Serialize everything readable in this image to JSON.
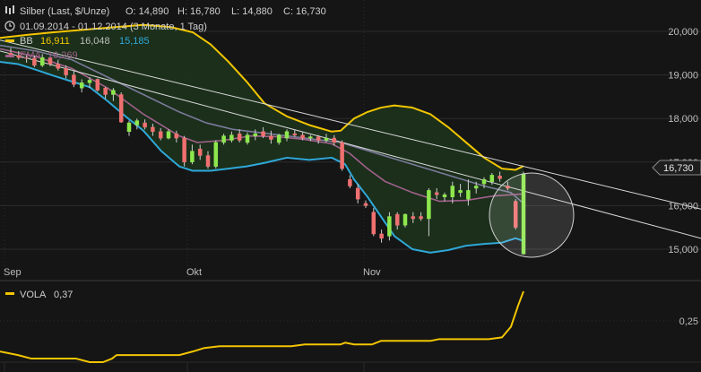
{
  "header": {
    "instrument_line": "Silber (Last, $/Unze)",
    "open": "O: 14,890",
    "high": "H: 16,780",
    "low": "L: 14,880",
    "close": "C: 16,730",
    "period_line": "01.09.2014 - 01.12.2014 (3 Monate, 1 Tag)",
    "bb_label": "BB",
    "bb_values": [
      "16,911",
      "16,048",
      "15,185"
    ],
    "ema_label": "EMA",
    "ema_value": "16,269"
  },
  "price_tag": "16,730",
  "vola": {
    "label": "VOLA",
    "value": "0,37"
  },
  "colors": {
    "background": "#151515",
    "grid": "#2c2c2c",
    "bb_upper": "#f2c500",
    "bb_lower": "#2fa8d8",
    "bb_mid": "#c8c8c8",
    "bb_fill": "#1b301b",
    "ema": "#a0608a",
    "sma": "#7a7a9a",
    "up": "#8ee84d",
    "down": "#f07070",
    "vola": "#f2c500"
  },
  "chart_data": {
    "type": "candlestick",
    "instrument": "Silber",
    "y_ticks": [
      "20,000",
      "19,000",
      "18,000",
      "17,000",
      "16,000",
      "15,000"
    ],
    "ylim": [
      14.6,
      20.4
    ],
    "x_labels": [
      "Sep",
      "Okt",
      "Nov"
    ],
    "candles": [
      [
        19.5,
        19.62,
        19.4,
        19.45
      ],
      [
        19.45,
        19.55,
        19.35,
        19.4
      ],
      [
        19.4,
        19.45,
        19.28,
        19.38
      ],
      [
        19.38,
        19.45,
        19.18,
        19.22
      ],
      [
        19.22,
        19.48,
        19.18,
        19.4
      ],
      [
        19.4,
        19.42,
        19.2,
        19.25
      ],
      [
        19.25,
        19.35,
        19.1,
        19.15
      ],
      [
        19.15,
        19.22,
        18.92,
        19.0
      ],
      [
        19.0,
        19.1,
        18.72,
        18.78
      ],
      [
        18.7,
        18.9,
        18.6,
        18.82
      ],
      [
        18.82,
        18.95,
        18.7,
        18.88
      ],
      [
        18.9,
        18.92,
        18.62,
        18.65
      ],
      [
        18.7,
        18.72,
        18.45,
        18.55
      ],
      [
        18.55,
        18.7,
        18.4,
        18.65
      ],
      [
        18.55,
        18.6,
        17.9,
        17.92
      ],
      [
        17.7,
        17.95,
        17.6,
        17.9
      ],
      [
        17.85,
        18.0,
        17.75,
        17.95
      ],
      [
        17.9,
        17.98,
        17.75,
        17.8
      ],
      [
        17.8,
        17.88,
        17.6,
        17.7
      ],
      [
        17.7,
        17.78,
        17.5,
        17.55
      ],
      [
        17.55,
        17.75,
        17.52,
        17.7
      ],
      [
        17.65,
        17.72,
        17.45,
        17.55
      ],
      [
        17.55,
        17.6,
        16.9,
        17.0
      ],
      [
        17.0,
        17.4,
        16.95,
        17.25
      ],
      [
        17.3,
        17.4,
        17.05,
        17.15
      ],
      [
        17.15,
        17.25,
        16.85,
        16.9
      ],
      [
        16.9,
        17.5,
        16.85,
        17.45
      ],
      [
        17.45,
        17.65,
        17.4,
        17.6
      ],
      [
        17.5,
        17.7,
        17.45,
        17.62
      ],
      [
        17.65,
        17.75,
        17.45,
        17.5
      ],
      [
        17.45,
        17.68,
        17.4,
        17.62
      ],
      [
        17.6,
        17.75,
        17.5,
        17.65
      ],
      [
        17.7,
        17.8,
        17.55,
        17.6
      ],
      [
        17.6,
        17.72,
        17.42,
        17.52
      ],
      [
        17.45,
        17.65,
        17.4,
        17.62
      ],
      [
        17.55,
        17.75,
        17.48,
        17.7
      ],
      [
        17.65,
        17.75,
        17.58,
        17.62
      ],
      [
        17.62,
        17.68,
        17.5,
        17.55
      ],
      [
        17.55,
        17.62,
        17.48,
        17.58
      ],
      [
        17.58,
        17.62,
        17.42,
        17.5
      ],
      [
        17.5,
        17.65,
        17.45,
        17.55
      ],
      [
        17.55,
        17.62,
        17.38,
        17.45
      ],
      [
        17.45,
        17.5,
        16.8,
        16.85
      ],
      [
        16.6,
        16.7,
        16.4,
        16.45
      ],
      [
        16.4,
        16.5,
        16.05,
        16.15
      ],
      [
        16.05,
        16.12,
        15.95,
        16.0
      ],
      [
        15.85,
        15.95,
        15.3,
        15.35
      ],
      [
        15.35,
        15.45,
        15.15,
        15.25
      ],
      [
        15.3,
        15.85,
        15.2,
        15.75
      ],
      [
        15.8,
        15.85,
        15.45,
        15.55
      ],
      [
        15.55,
        15.82,
        15.5,
        15.8
      ],
      [
        15.75,
        15.85,
        15.6,
        15.7
      ],
      [
        15.75,
        15.85,
        15.65,
        15.7
      ],
      [
        15.7,
        16.4,
        15.3,
        16.35
      ],
      [
        16.3,
        16.4,
        16.15,
        16.25
      ],
      [
        16.2,
        16.3,
        16.1,
        16.25
      ],
      [
        16.2,
        16.55,
        16.05,
        16.45
      ],
      [
        16.3,
        16.5,
        16.2,
        16.35
      ],
      [
        16.15,
        16.6,
        16.0,
        16.35
      ],
      [
        16.4,
        16.55,
        16.28,
        16.45
      ],
      [
        16.5,
        16.65,
        16.4,
        16.6
      ],
      [
        16.55,
        16.75,
        16.48,
        16.7
      ],
      [
        16.68,
        16.78,
        16.55,
        16.62
      ],
      [
        16.45,
        16.55,
        16.35,
        16.4
      ],
      [
        16.1,
        16.15,
        15.45,
        15.5
      ],
      [
        14.89,
        16.78,
        14.88,
        16.73
      ]
    ],
    "bb_upper": [
      [
        0,
        19.85
      ],
      [
        30,
        19.92
      ],
      [
        60,
        19.98
      ],
      [
        100,
        20.05
      ],
      [
        130,
        20.1
      ],
      [
        160,
        20.15
      ],
      [
        190,
        20.1
      ],
      [
        215,
        19.98
      ],
      [
        235,
        19.7
      ],
      [
        255,
        19.3
      ],
      [
        275,
        18.85
      ],
      [
        295,
        18.35
      ],
      [
        320,
        18.05
      ],
      [
        345,
        17.85
      ],
      [
        370,
        17.7
      ],
      [
        380,
        17.72
      ],
      [
        395,
        18.0
      ],
      [
        410,
        18.15
      ],
      [
        425,
        18.25
      ],
      [
        440,
        18.3
      ],
      [
        460,
        18.25
      ],
      [
        480,
        18.1
      ],
      [
        500,
        17.8
      ],
      [
        520,
        17.45
      ],
      [
        540,
        17.1
      ],
      [
        560,
        16.85
      ],
      [
        575,
        16.82
      ],
      [
        584,
        16.91
      ]
    ],
    "bb_lower": [
      [
        0,
        19.3
      ],
      [
        20,
        19.25
      ],
      [
        40,
        19.12
      ],
      [
        60,
        18.98
      ],
      [
        80,
        18.85
      ],
      [
        100,
        18.72
      ],
      [
        120,
        18.4
      ],
      [
        140,
        18.05
      ],
      [
        160,
        17.72
      ],
      [
        180,
        17.25
      ],
      [
        200,
        16.9
      ],
      [
        215,
        16.8
      ],
      [
        235,
        16.8
      ],
      [
        255,
        16.85
      ],
      [
        275,
        16.9
      ],
      [
        295,
        16.98
      ],
      [
        320,
        17.1
      ],
      [
        345,
        17.05
      ],
      [
        370,
        17.1
      ],
      [
        385,
        16.95
      ],
      [
        395,
        16.6
      ],
      [
        410,
        16.2
      ],
      [
        425,
        15.75
      ],
      [
        440,
        15.3
      ],
      [
        460,
        15.0
      ],
      [
        480,
        14.92
      ],
      [
        500,
        14.98
      ],
      [
        520,
        15.08
      ],
      [
        540,
        15.12
      ],
      [
        560,
        15.15
      ],
      [
        575,
        15.25
      ],
      [
        584,
        15.19
      ]
    ],
    "ema": [
      [
        0,
        19.6
      ],
      [
        40,
        19.42
      ],
      [
        80,
        19.15
      ],
      [
        120,
        18.7
      ],
      [
        160,
        18.1
      ],
      [
        200,
        17.6
      ],
      [
        220,
        17.45
      ],
      [
        250,
        17.5
      ],
      [
        280,
        17.6
      ],
      [
        310,
        17.58
      ],
      [
        340,
        17.52
      ],
      [
        370,
        17.42
      ],
      [
        390,
        17.2
      ],
      [
        410,
        16.85
      ],
      [
        430,
        16.55
      ],
      [
        460,
        16.3
      ],
      [
        490,
        16.1
      ],
      [
        520,
        16.12
      ],
      [
        550,
        16.22
      ],
      [
        570,
        16.25
      ],
      [
        584,
        16.27
      ]
    ],
    "sma": [
      [
        0,
        19.68
      ],
      [
        40,
        19.55
      ],
      [
        80,
        19.35
      ],
      [
        120,
        18.95
      ],
      [
        160,
        18.55
      ],
      [
        200,
        18.15
      ],
      [
        230,
        17.9
      ],
      [
        260,
        17.75
      ],
      [
        300,
        17.65
      ],
      [
        340,
        17.55
      ],
      [
        380,
        17.45
      ],
      [
        420,
        17.2
      ],
      [
        460,
        16.95
      ],
      [
        500,
        16.7
      ],
      [
        540,
        16.45
      ],
      [
        570,
        16.3
      ],
      [
        584,
        16.05
      ]
    ],
    "trendlines": [
      [
        [
          0,
          19.8
        ],
        [
          782,
          15.92
        ]
      ],
      [
        [
          0,
          19.55
        ],
        [
          782,
          15.25
        ]
      ]
    ],
    "vola": {
      "label": "VOLA",
      "value": "0,37",
      "y_ticks": [
        "0,25"
      ],
      "points": [
        [
          0,
          0.2
        ],
        [
          20,
          0.19
        ],
        [
          35,
          0.18
        ],
        [
          60,
          0.18
        ],
        [
          85,
          0.18
        ],
        [
          100,
          0.17
        ],
        [
          115,
          0.17
        ],
        [
          125,
          0.18
        ],
        [
          130,
          0.19
        ],
        [
          160,
          0.19
        ],
        [
          190,
          0.19
        ],
        [
          200,
          0.19
        ],
        [
          215,
          0.2
        ],
        [
          228,
          0.21
        ],
        [
          245,
          0.215
        ],
        [
          275,
          0.215
        ],
        [
          300,
          0.215
        ],
        [
          325,
          0.215
        ],
        [
          340,
          0.22
        ],
        [
          370,
          0.22
        ],
        [
          380,
          0.22
        ],
        [
          385,
          0.225
        ],
        [
          395,
          0.22
        ],
        [
          415,
          0.22
        ],
        [
          425,
          0.23
        ],
        [
          440,
          0.23
        ],
        [
          460,
          0.23
        ],
        [
          480,
          0.23
        ],
        [
          490,
          0.235
        ],
        [
          510,
          0.235
        ],
        [
          545,
          0.235
        ],
        [
          560,
          0.24
        ],
        [
          570,
          0.27
        ],
        [
          578,
          0.33
        ],
        [
          584,
          0.37
        ]
      ]
    }
  }
}
